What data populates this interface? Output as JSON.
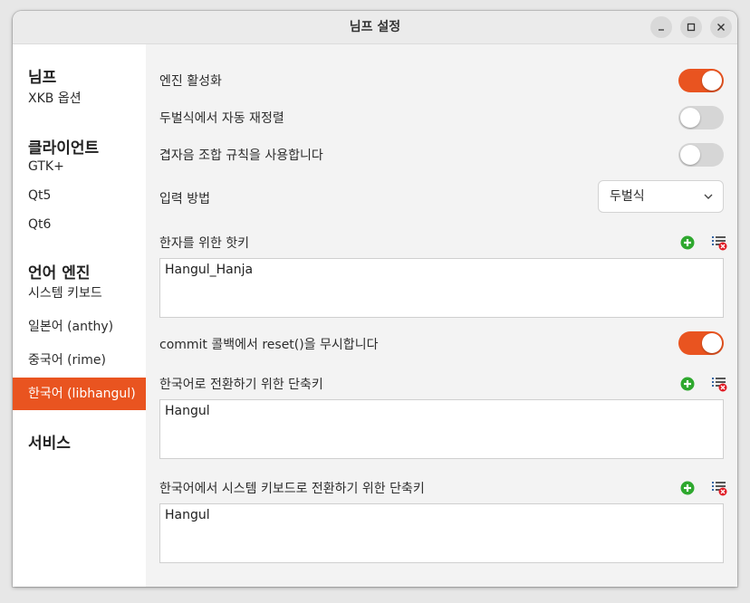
{
  "window": {
    "title": "님프 설정"
  },
  "sidebar": {
    "headings": [
      "님프",
      "클라이언트",
      "언어 엔진",
      "서비스"
    ],
    "items": [
      {
        "label": "XKB 옵션"
      },
      {
        "label": "GTK+"
      },
      {
        "label": "Qt5"
      },
      {
        "label": "Qt6"
      },
      {
        "label": "시스템 키보드"
      },
      {
        "label": "일본어 (anthy)"
      },
      {
        "label": "중국어 (rime)"
      },
      {
        "label": "한국어 (libhangul)",
        "active": true
      }
    ]
  },
  "settings": {
    "engine_enable": {
      "label": "엔진 활성화",
      "value": true
    },
    "auto_reorder": {
      "label": "두벌식에서 자동 재정렬",
      "value": false
    },
    "compose_rule": {
      "label": "겹자음 조합 규칙을 사용합니다",
      "value": false
    },
    "input_method": {
      "label": "입력 방법",
      "value": "두벌식"
    },
    "hanja_hotkey": {
      "label": "한자를 위한 핫키",
      "value": "Hangul_Hanja"
    },
    "ignore_reset": {
      "label": "commit 콜백에서 reset()을 무시합니다",
      "value": true
    },
    "to_korean_shortcut": {
      "label": "한국어로 전환하기 위한 단축키",
      "value": "Hangul"
    },
    "to_system_shortcut": {
      "label": "한국어에서 시스템 키보드로 전환하기 위한 단축키",
      "value": "Hangul"
    }
  },
  "colors": {
    "accent": "#e95420",
    "add_icon": "#2ea82e",
    "remove_icon": "#e01b24"
  },
  "icons": {
    "add": "list-add-icon",
    "remove": "list-remove-icon",
    "minimize": "minimize-icon",
    "maximize": "maximize-icon",
    "close": "close-icon",
    "dropdown": "chevron-down-icon"
  }
}
